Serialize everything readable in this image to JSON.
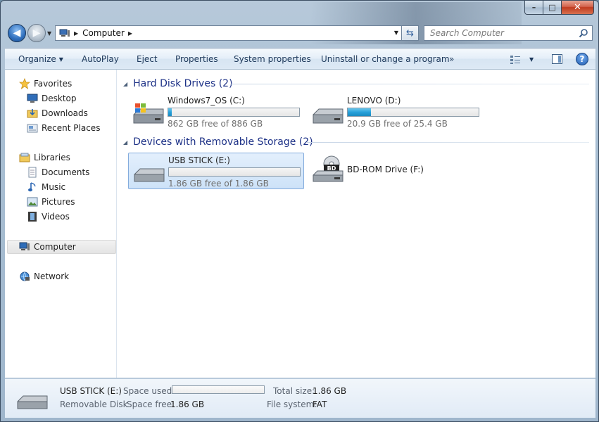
{
  "window": {
    "caption_buttons": {
      "minimize": "–",
      "maximize": "□",
      "close": "✕"
    }
  },
  "navigation": {
    "back_icon": "back-arrow-icon",
    "forward_icon": "forward-arrow-icon",
    "address_crumb": "Computer",
    "search_placeholder": "Search Computer"
  },
  "toolbar": {
    "organize": "Organize",
    "autoplay": "AutoPlay",
    "eject": "Eject",
    "properties": "Properties",
    "system_properties": "System properties",
    "uninstall": "Uninstall or change a program",
    "more": "»",
    "help": "?"
  },
  "sidebar": {
    "favorites": {
      "label": "Favorites",
      "items": [
        "Desktop",
        "Downloads",
        "Recent Places"
      ]
    },
    "libraries": {
      "label": "Libraries",
      "items": [
        "Documents",
        "Music",
        "Pictures",
        "Videos"
      ]
    },
    "computer": "Computer",
    "network": "Network"
  },
  "groups": {
    "hard_disks": {
      "header": "Hard Disk Drives (2)",
      "drives": [
        {
          "name": "Windows7_OS (C:)",
          "free_text": "862 GB free of 886 GB",
          "used_fraction": 0.027
        },
        {
          "name": "LENOVO (D:)",
          "free_text": "20.9 GB free of 25.4 GB",
          "used_fraction": 0.177
        }
      ]
    },
    "removable": {
      "header": "Devices with Removable Storage (2)",
      "drives": [
        {
          "name": "USB STICK (E:)",
          "free_text": "1.86 GB free of 1.86 GB",
          "used_fraction": 0.0
        },
        {
          "name": "BD-ROM Drive (F:)"
        }
      ]
    }
  },
  "details": {
    "name": "USB STICK (E:)",
    "type": "Removable Disk",
    "space_used_label": "Space used:",
    "space_used_fraction": 0.0,
    "space_free_label": "Space free:",
    "space_free": "1.86 GB",
    "total_size_label": "Total size:",
    "total_size": "1.86 GB",
    "file_system_label": "File system:",
    "file_system": "FAT"
  },
  "colors": {
    "accent_blue": "#26a0da",
    "group_header": "#1e3287",
    "selection": "#cde2f8"
  }
}
